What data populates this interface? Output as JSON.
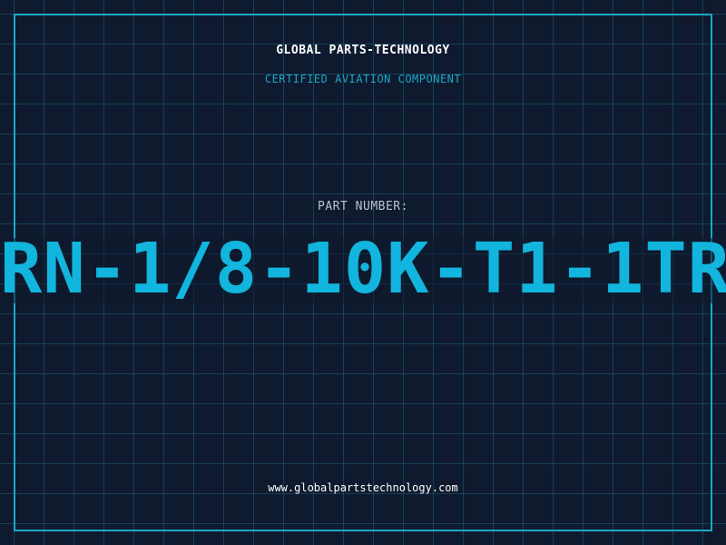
{
  "header": {
    "brand": "GLOBAL PARTS-TECHNOLOGY",
    "subtitle": "CERTIFIED AVIATION COMPONENT"
  },
  "part": {
    "label": "PART NUMBER:",
    "number": "RN-1/8-10K-T1-1TR"
  },
  "footer": {
    "website": "www.globalpartstechnology.com"
  },
  "colors": {
    "background": "#0f1a2e",
    "accent": "#1aa7c9",
    "grid": "#1e6e8c",
    "text": "#ffffff",
    "label": "#b8c4d2"
  }
}
